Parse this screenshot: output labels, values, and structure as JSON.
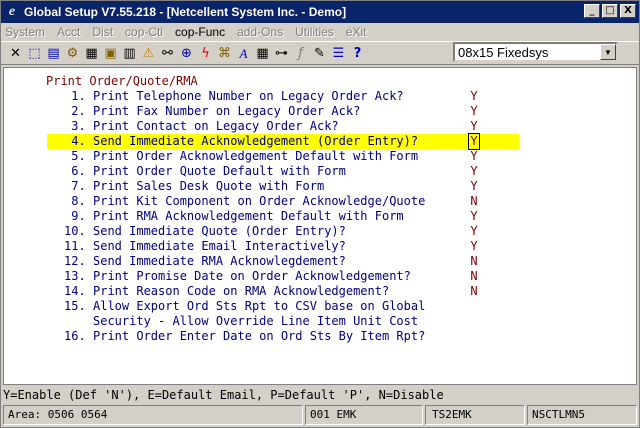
{
  "window": {
    "title": "Global Setup V7.55.218 - [Netcellent System Inc. - Demo]",
    "controls": {
      "minimize": "_",
      "maximize": "□",
      "close": "X"
    }
  },
  "menu": [
    {
      "label": "System",
      "active": false
    },
    {
      "label": "Acct",
      "active": false
    },
    {
      "label": "Dist",
      "active": false
    },
    {
      "label": "cop-Ctl",
      "active": false
    },
    {
      "label": "cop-Func",
      "active": true
    },
    {
      "label": "add-Ons",
      "active": false
    },
    {
      "label": "Utilities",
      "active": false
    },
    {
      "label": "eXit",
      "active": false
    }
  ],
  "toolbar": {
    "font_select": {
      "value": "08x15 Fixedsys"
    }
  },
  "screen": {
    "heading": "Print Order/Quote/RMA",
    "options": [
      {
        "num": " 1.",
        "label": "Print Telephone Number on Legacy Order Ack?",
        "value": "Y"
      },
      {
        "num": " 2.",
        "label": "Print Fax Number on Legacy Order Ack?",
        "value": "Y"
      },
      {
        "num": " 3.",
        "label": "Print Contact on Legacy Order Ack?",
        "value": "Y"
      },
      {
        "num": " 4.",
        "label": "Send Immediate Acknowledgement (Order Entry)?",
        "value": "Y"
      },
      {
        "num": " 5.",
        "label": "Print Order Acknowledgement Default with Form",
        "value": "Y"
      },
      {
        "num": " 6.",
        "label": "Print Order Quote Default with Form",
        "value": "Y"
      },
      {
        "num": " 7.",
        "label": "Print Sales Desk Quote with Form",
        "value": "Y"
      },
      {
        "num": " 8.",
        "label": "Print Kit Component on Order Acknowledge/Quote",
        "value": "N"
      },
      {
        "num": " 9.",
        "label": "Print RMA Acknowledgement Default with Form",
        "value": "Y"
      },
      {
        "num": "10.",
        "label": "Send Immediate Quote (Order Entry)?",
        "value": "Y"
      },
      {
        "num": "11.",
        "label": "Send Immediate Email Interactively?",
        "value": "Y"
      },
      {
        "num": "12.",
        "label": "Send Immediate RMA Acknowlegdement?",
        "value": "N"
      },
      {
        "num": "13.",
        "label": "Print Promise Date on Order Acknowledgement?",
        "value": "N"
      },
      {
        "num": "14.",
        "label": "Print Reason Code on RMA Acknowledgement?",
        "value": "N"
      },
      {
        "num": "15.",
        "label": "Allow Export Ord Sts Rpt to CSV base on Global",
        "value": ""
      },
      {
        "num": "",
        "label": "Security - Allow Override Line Item Unit Cost",
        "value": ""
      },
      {
        "num": "16.",
        "label": "Print Order Enter Date on Ord Sts By Item Rpt?",
        "value": ""
      }
    ],
    "selected_index": 3
  },
  "help_line": "Y=Enable (Def 'N'), E=Default Email, P=Default 'P', N=Disable",
  "status": {
    "area": "Area: 0506 0564",
    "company": "001 EMK",
    "terminal": "TS2EMK",
    "program": "NSCTLMN5"
  }
}
